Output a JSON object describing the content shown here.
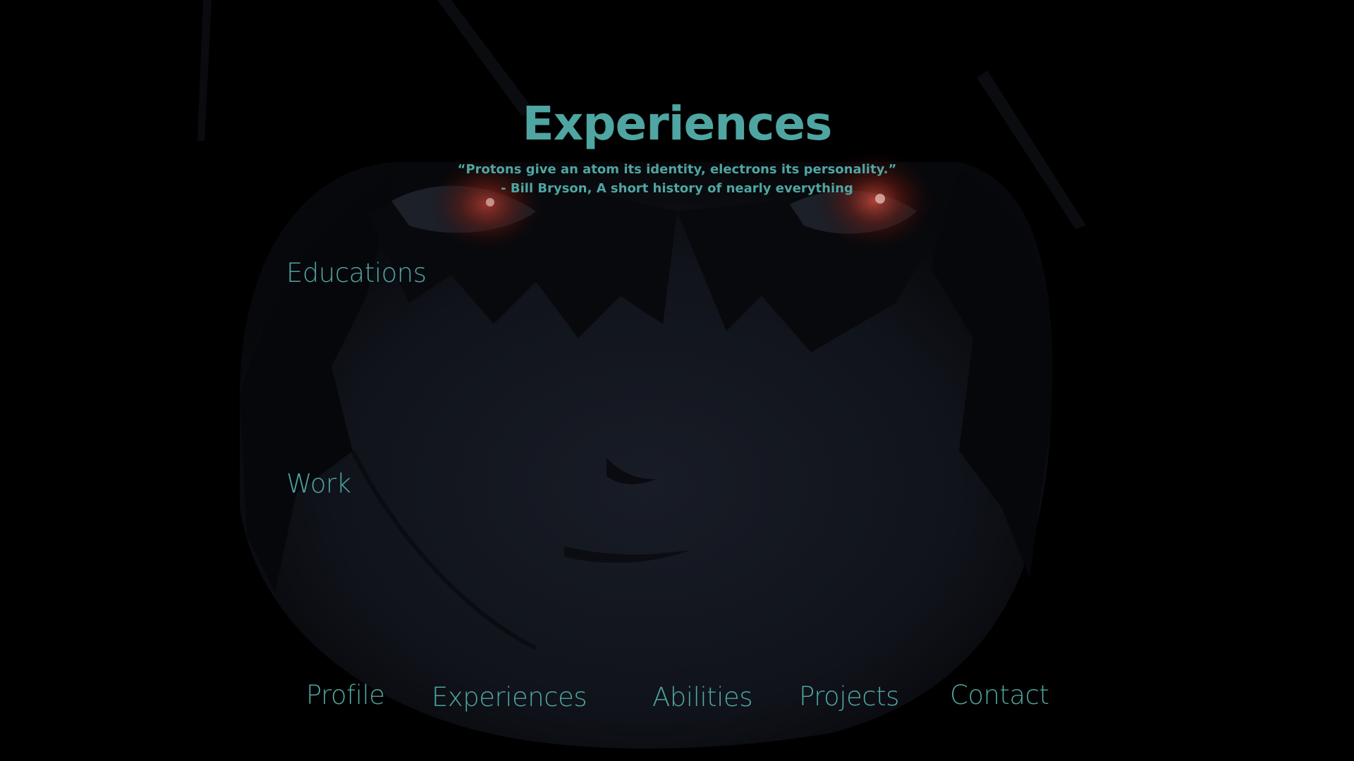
{
  "page": {
    "title": "Experiences",
    "quote_line1": "“Protons give an atom its identity, electrons its personality.”",
    "quote_line2": "- Bill Bryson, A short history of nearly everything"
  },
  "sections": {
    "educations_label": "Educations",
    "work_label": "Work"
  },
  "nav": {
    "profile": "Profile",
    "experiences": "Experiences",
    "abilities": "Abilities",
    "projects": "Projects",
    "contact": "Contact"
  },
  "colors": {
    "accent": "#4fa5a2",
    "background": "#000000",
    "figure": "#12151c",
    "eye_glow": "#6b1a10"
  },
  "background_art": "dark-anime-face-illustration"
}
